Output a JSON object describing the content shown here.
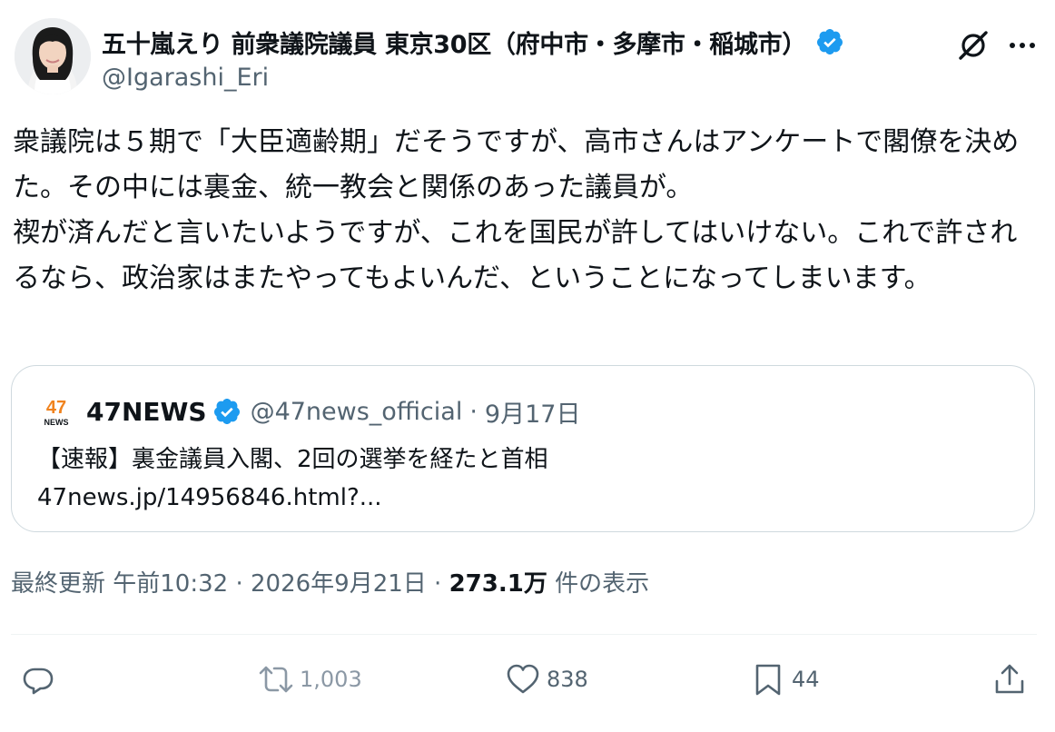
{
  "author": {
    "display_name": "五十嵐えり 前衆議院議員 東京30区（府中市・多摩市・稲城市）",
    "handle": "@Igarashi_Eri",
    "verified": true,
    "verified_color": "#1d9bf0"
  },
  "header_icons": {
    "grok": "grok-icon",
    "more": "more-icon"
  },
  "tweet": {
    "text": "衆議院は５期で「大臣適齢期」だそうですが、高市さんはアンケートで閣僚を決めた。その中には裏金、統一教会と関係のあった議員が。\n禊が済んだと言いたいようですが、これを国民が許してはいけない。これで許されるなら、政治家はまたやってもよいんだ、ということになってしまいます。"
  },
  "quote": {
    "logo_text": "47",
    "logo_subtext": "NEWS",
    "name": "47NEWS",
    "verified": true,
    "handle": "@47news_official",
    "separator": "·",
    "date": "9月17日",
    "text_line1": "【速報】裏金議員入閣、2回の選挙を経たと首相",
    "text_line2": "47news.jp/14956846.html?..."
  },
  "meta": {
    "prefix": "最終更新 午前10:32 · 2026年9月21日 · ",
    "views_count": "273.1万",
    "views_suffix": " 件の表示"
  },
  "actions": {
    "reply_icon": "reply-icon",
    "retweet_icon": "retweet-icon",
    "retweet_count": "1,003",
    "like_icon": "like-icon",
    "like_count": "838",
    "bookmark_icon": "bookmark-icon",
    "bookmark_count": "44",
    "share_icon": "share-icon"
  },
  "colors": {
    "text": "#0f1419",
    "secondary": "#536471",
    "border": "#cfd9de",
    "accent": "#1d9bf0",
    "logo_orange": "#f0831e"
  }
}
